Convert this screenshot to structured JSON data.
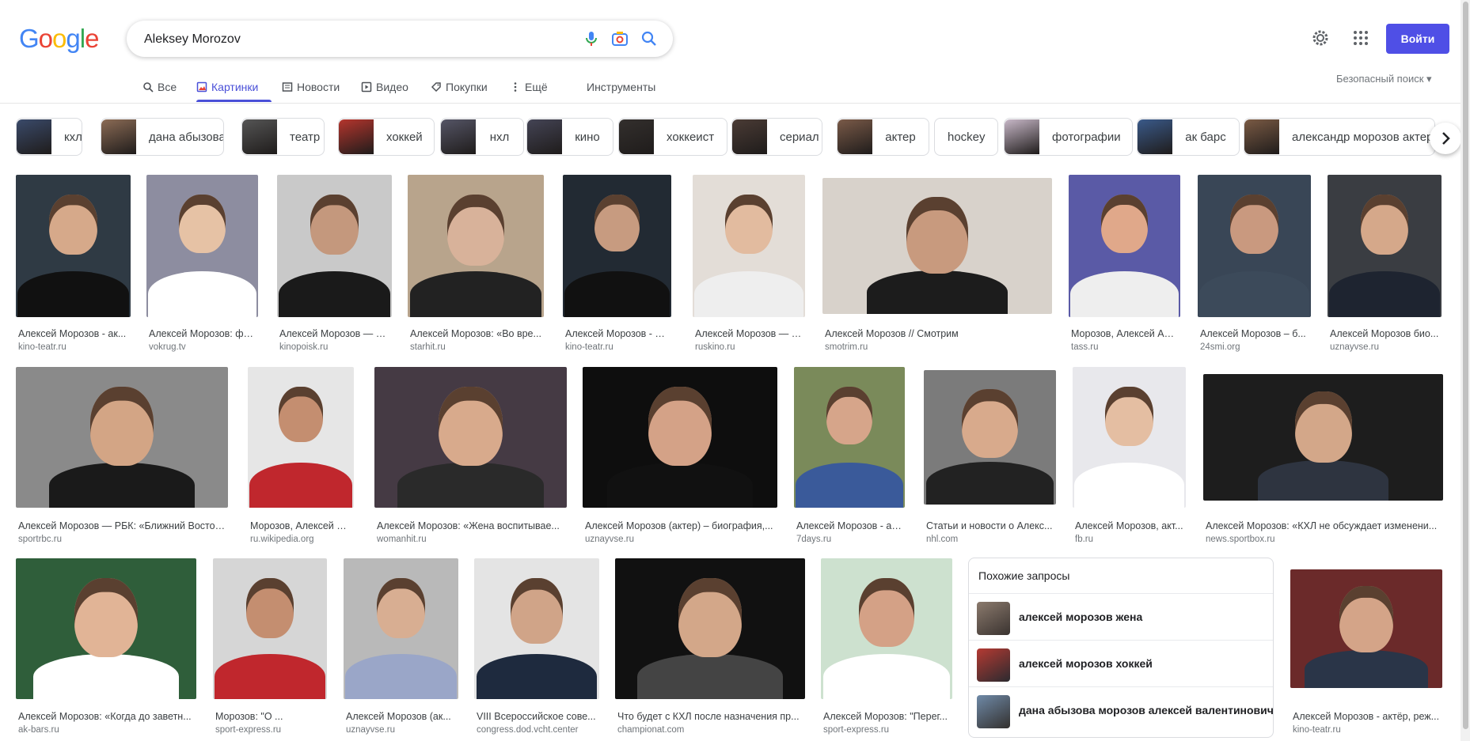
{
  "logo": {
    "text": "Google",
    "letters": [
      {
        "ch": "G",
        "color": "#4285f4"
      },
      {
        "ch": "o",
        "color": "#ea4335"
      },
      {
        "ch": "o",
        "color": "#fbbc05"
      },
      {
        "ch": "g",
        "color": "#4285f4"
      },
      {
        "ch": "l",
        "color": "#34a853"
      },
      {
        "ch": "e",
        "color": "#ea4335"
      }
    ]
  },
  "search": {
    "value": "Aleksey Morozov"
  },
  "header": {
    "signin_label": "Войти"
  },
  "tabs": [
    {
      "label": "Все",
      "icon": "search-icon"
    },
    {
      "label": "Картинки",
      "icon": "image-icon",
      "active": true
    },
    {
      "label": "Новости",
      "icon": "news-icon"
    },
    {
      "label": "Видео",
      "icon": "video-icon"
    },
    {
      "label": "Покупки",
      "icon": "tag-icon"
    },
    {
      "label": "Ещё",
      "icon": "more-vert-icon"
    },
    {
      "label": "Инструменты",
      "icon": ""
    }
  ],
  "safesearch": {
    "label": "Безопасный поиск ▾"
  },
  "chips": [
    "кхл",
    "дана абызова",
    "театр",
    "хоккей",
    "нхл",
    "кино",
    "хоккеист",
    "сериал",
    "актер",
    "hockey",
    "фотографии",
    "ак барс",
    "александр морозов актер"
  ],
  "results": [
    {
      "caption": "Алексей Морозов - ак...",
      "source": "kino-teatr.ru"
    },
    {
      "caption": "Алексей Морозов: фо...",
      "source": "vokrug.tv"
    },
    {
      "caption": "Алексей Морозов — ф...",
      "source": "kinopoisk.ru"
    },
    {
      "caption": "Алексей Морозов: «Во вре...",
      "source": "starhit.ru"
    },
    {
      "caption": "Алексей Морозов - ак...",
      "source": "kino-teatr.ru"
    },
    {
      "caption": "Алексей Морозов — б...",
      "source": "ruskino.ru"
    },
    {
      "caption": "Алексей Морозов // Смотрим",
      "source": "smotrim.ru"
    },
    {
      "caption": "Морозов, Алексей Ал...",
      "source": "tass.ru"
    },
    {
      "caption": "Алексей Морозов – б...",
      "source": "24smi.org"
    },
    {
      "caption": "Алексей Морозов био...",
      "source": "uznayvse.ru"
    },
    {
      "caption": "Алексей Морозов — РБК: «Ближний Восток...",
      "source": "sportrbc.ru"
    },
    {
      "caption": "Морозов, Алексей Ал...",
      "source": "ru.wikipedia.org"
    },
    {
      "caption": "Алексей Морозов: «Жена воспитывае...",
      "source": "womanhit.ru"
    },
    {
      "caption": "Алексей Морозов (актер) – биография,...",
      "source": "uznayvse.ru"
    },
    {
      "caption": "Алексей Морозов - ак...",
      "source": "7days.ru"
    },
    {
      "caption": "Статьи и новости о Алекс...",
      "source": "nhl.com"
    },
    {
      "caption": "Алексей Морозов, акт...",
      "source": "fb.ru"
    },
    {
      "caption": "Алексей Морозов: «КХЛ не обсуждает изменени...",
      "source": "news.sportbox.ru"
    },
    {
      "caption": "Алексей Морозов: «Когда до заветн...",
      "source": "ak-bars.ru"
    },
    {
      "caption": "Морозов: \"О ...",
      "source": "sport-express.ru"
    },
    {
      "caption": "Алексей Морозов (ак...",
      "source": "uznayvse.ru"
    },
    {
      "caption": "VIII Всероссийское сове...",
      "source": "congress.dod.vcht.center"
    },
    {
      "caption": "Что будет с КХЛ после назначения пр...",
      "source": "championat.com"
    },
    {
      "caption": "Алексей Морозов: \"Перег...",
      "source": "sport-express.ru"
    },
    {
      "caption": "Алексей Морозов - актёр, реж...",
      "source": "kino-teatr.ru"
    }
  ],
  "related": {
    "title": "Похожие запросы",
    "items": [
      "алексей морозов жена",
      "алексей морозов хоккей",
      "дана абызова морозов алексей валентинович"
    ]
  }
}
